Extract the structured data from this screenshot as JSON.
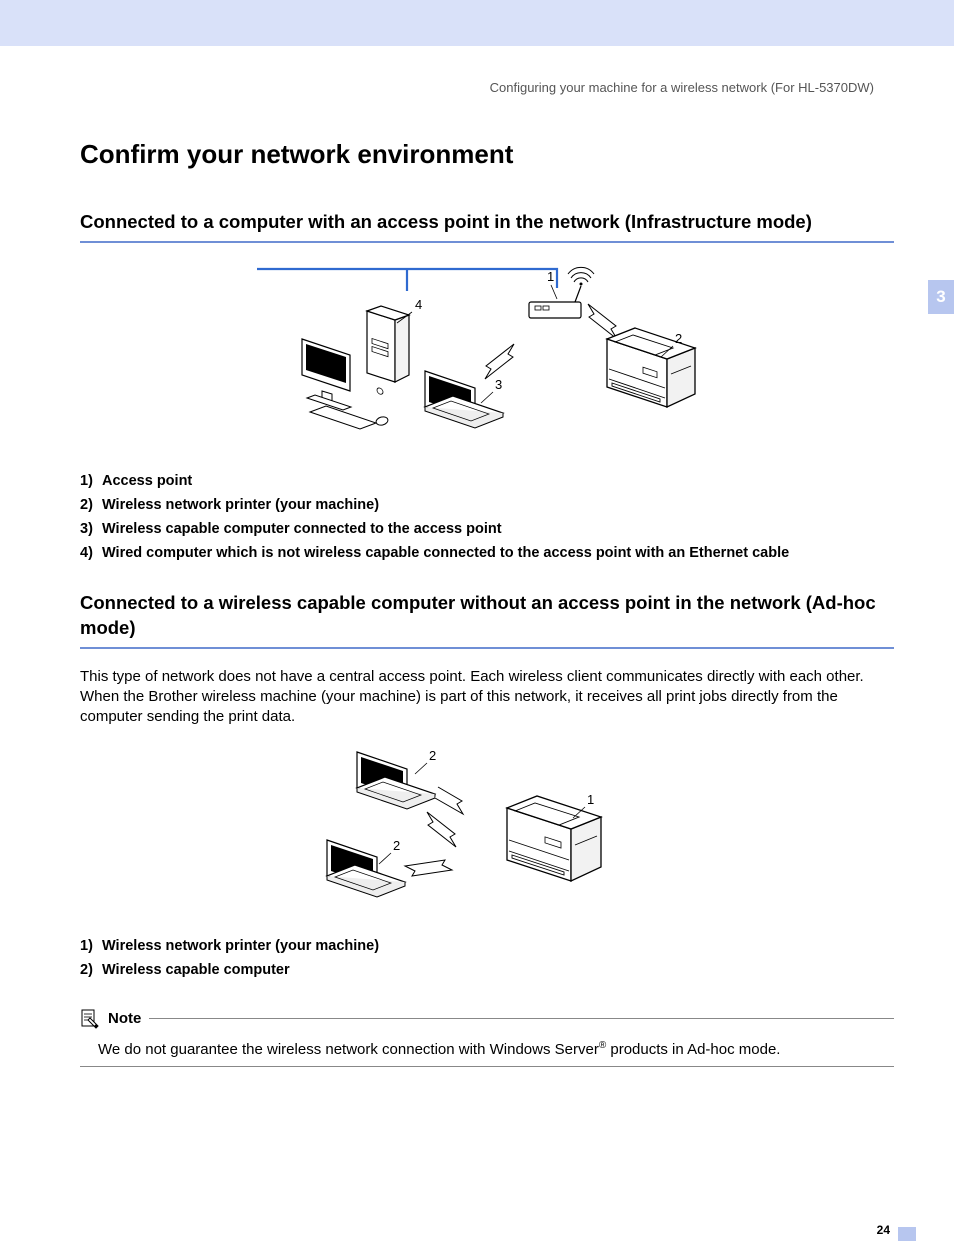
{
  "running_head": "Configuring your machine for a wireless network (For HL-5370DW)",
  "chapter_tab": "3",
  "title": "Confirm your network environment",
  "section1": {
    "heading": "Connected to a computer with an access point in the network (Infrastructure mode)",
    "callouts": {
      "c1": "1",
      "c2": "2",
      "c3": "3",
      "c4": "4"
    },
    "legend": [
      {
        "n": "1)",
        "t": "Access point"
      },
      {
        "n": "2)",
        "t": "Wireless network printer (your machine)"
      },
      {
        "n": "3)",
        "t": "Wireless capable computer connected to the access point"
      },
      {
        "n": "4)",
        "t": "Wired computer which is not wireless capable connected to the access point with an Ethernet cable"
      }
    ]
  },
  "section2": {
    "heading": "Connected to a wireless capable computer without an access point in the network (Ad-hoc mode)",
    "body": "This type of network does not have a central access point. Each wireless client communicates directly with each other. When the Brother wireless machine (your machine) is part of this network, it receives all print jobs directly from the computer sending the print data.",
    "callouts": {
      "c1": "1",
      "c2a": "2",
      "c2b": "2"
    },
    "legend": [
      {
        "n": "1)",
        "t": "Wireless network printer (your machine)"
      },
      {
        "n": "2)",
        "t": "Wireless capable computer"
      }
    ]
  },
  "note": {
    "label": "Note",
    "body_pre": "We do not guarantee the wireless network connection with Windows Server",
    "body_sup": "®",
    "body_post": " products in Ad-hoc mode."
  },
  "page_number": "24"
}
